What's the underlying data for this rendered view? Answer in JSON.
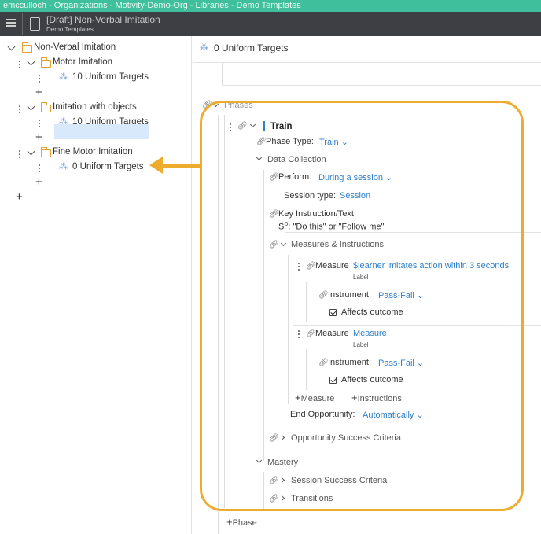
{
  "topbar": {
    "breadcrumb": "emcculloch - Organizations - Motivity-Demo-Org - Libraries - Demo Templates"
  },
  "header": {
    "title": "[Draft] Non-Verbal Imitation",
    "subtitle": "Demo Templates"
  },
  "tree": {
    "root_label": "Non-Verbal Imitation",
    "groups": [
      {
        "label": "Motor Imitation",
        "target": "10 Uniform Targets"
      },
      {
        "label": "Imitation with objects",
        "target": "10 Uniform Targets"
      },
      {
        "label": "Fine Motor Imitation",
        "target": "0 Uniform Targets"
      }
    ]
  },
  "content": {
    "heading": "0 Uniform Targets",
    "phases_label": "Phases",
    "phase_name": "Train",
    "phase_type_label": "Phase Type:",
    "phase_type_value": "Train",
    "data_collection_label": "Data Collection",
    "perform_label": "Perform:",
    "perform_value": "During a session",
    "session_type_label": "Session type:",
    "session_type_value": "Session",
    "key_instruction_label": "Key Instruction/Text",
    "sd_prefix": "S",
    "sd_sup": "D",
    "key_instruction_value": ": \"Do this\" or \"Follow me\"",
    "measures_label": "Measures & Instructions",
    "measures": [
      {
        "label": "Measure",
        "value": "$learner imitates action within 3 seconds",
        "sublabel": "Label",
        "instrument_label": "Instrument:",
        "instrument_value": "Pass-Fail",
        "affects_label": "Affects outcome"
      },
      {
        "label": "Measure",
        "value": "Measure",
        "sublabel": "Label",
        "instrument_label": "Instrument:",
        "instrument_value": "Pass-Fail",
        "affects_label": "Affects outcome"
      }
    ],
    "add_measure": "Measure",
    "add_instructions": "Instructions",
    "end_opportunity_label": "End Opportunity:",
    "end_opportunity_value": "Automatically",
    "opportunity_success_label": "Opportunity Success Criteria",
    "mastery_label": "Mastery",
    "session_success_label": "Session Success Criteria",
    "transitions_label": "Transitions",
    "add_phase": "Phase"
  },
  "colors": {
    "accent": "#3fbf9b",
    "header_bg": "#3d3f45",
    "link_blue": "#2f7fc9",
    "callout": "#eeac2e",
    "folder": "#e0a22a"
  }
}
